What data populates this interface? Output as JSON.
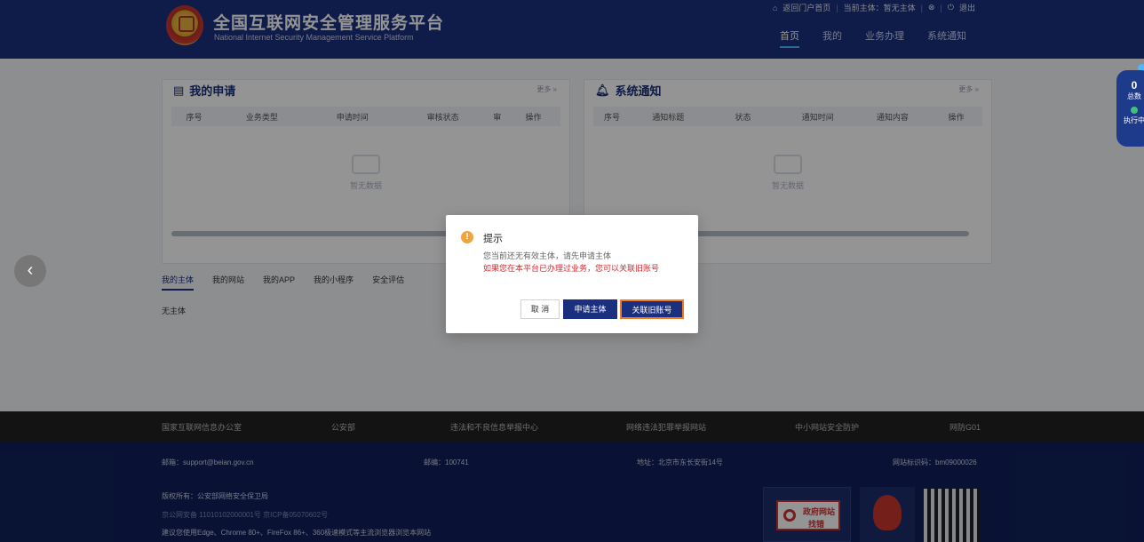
{
  "header": {
    "title_cn": "全国互联网安全管理服务平台",
    "title_en": "National Internet Security Management Service Platform",
    "top_links": {
      "home": "返回门户首页",
      "subject": "当前主体：暂无主体",
      "user": "⊗",
      "logout": "退出"
    },
    "nav": [
      "首页",
      "我的",
      "业务办理",
      "系统通知"
    ]
  },
  "applications": {
    "title": "我的申请",
    "more": "更多 »",
    "columns": [
      "序号",
      "业务类型",
      "申请时间",
      "审核状态",
      "审",
      "操作"
    ],
    "empty": "暂无数据"
  },
  "notices": {
    "title": "系统通知",
    "more": "更多 »",
    "columns": [
      "序号",
      "通知标题",
      "状态",
      "通知时间",
      "通知内容",
      "操作"
    ],
    "empty": "暂无数据"
  },
  "tabs": [
    "我的主体",
    "我的网站",
    "我的APP",
    "我的小程序",
    "安全评估"
  ],
  "no_subject": "无主体",
  "side_widget": {
    "count": "0",
    "count_label": "总数",
    "status_label": "执行中"
  },
  "dialog": {
    "title": "提示",
    "message": "您当前还无有效主体，请先申请主体",
    "warning": "如果您在本平台已办理过业务，您可以关联旧账号",
    "cancel": "取 消",
    "apply": "申请主体",
    "link": "关联旧账号"
  },
  "footer_links": [
    "国家互联网信息办公室",
    "公安部",
    "违法和不良信息举报中心",
    "网络违法犯罪举报网站",
    "中小网站安全防护",
    "网防G01"
  ],
  "footer": {
    "email": "邮箱：support@beian.gov.cn",
    "postcode": "邮编：100741",
    "address": "地址：北京市东长安街14号",
    "site_id": "网站标识码：bm09000026",
    "copyright": "版权所有：公安部网络安全保卫局",
    "icp": "京公网安备 11010102000001号    京ICP备05070602号",
    "browser": "建议您使用Edge、Chrome 80+、FireFox 86+、360极速模式等主流浏览器浏览本网站",
    "badge_text": "政府网站",
    "badge_sub": "找错"
  }
}
